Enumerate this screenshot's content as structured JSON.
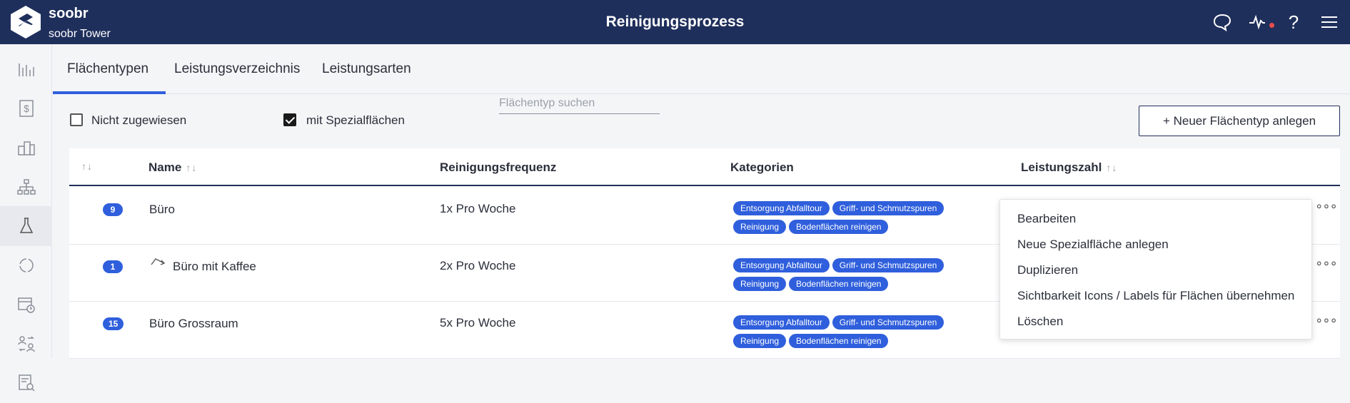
{
  "app": {
    "brand": "soobr",
    "location": "soobr Tower",
    "page_title": "Reinigungsprozess"
  },
  "colors": {
    "topbar": "#1f2f5c",
    "accent": "#2f5fdc",
    "notification_dot": "#e94c4c"
  },
  "header_icons": [
    "chat-icon",
    "activity-icon",
    "help-icon",
    "menu-icon"
  ],
  "help_label": "?",
  "sidebar_icons": [
    "bar-chart-icon",
    "dollar-document-icon",
    "buildings-icon",
    "hierarchy-icon",
    "flask-icon",
    "cycle-icon",
    "calendar-clock-icon",
    "people-swap-icon",
    "document-search-icon"
  ],
  "tabs": [
    {
      "label": "Flächentypen",
      "active": true
    },
    {
      "label": "Leistungsverzeichnis",
      "active": false
    },
    {
      "label": "Leistungsarten",
      "active": false
    }
  ],
  "filters": {
    "unassigned_label": "Nicht zugewiesen",
    "unassigned_checked": false,
    "special_label": "mit Spezialflächen",
    "special_checked": true,
    "search_placeholder": "Flächentyp suchen",
    "new_button": "+ Neuer Flächentyp anlegen"
  },
  "table": {
    "sort_arrows": "↑↓",
    "headers": {
      "name": "Name",
      "frequency": "Reinigungsfrequenz",
      "categories": "Kategorien",
      "performance": "Leistungszahl"
    },
    "rows": [
      {
        "count": "9",
        "name": "Büro",
        "frequency": "1x Pro Woche",
        "special": false,
        "categories": [
          "Entsorgung Abfalltour",
          "Griff- und Schmutzspuren",
          "Reinigung",
          "Bodenflächen reinigen"
        ]
      },
      {
        "count": "1",
        "name": "Büro mit Kaffee",
        "frequency": "2x Pro Woche",
        "special": true,
        "categories": [
          "Entsorgung Abfalltour",
          "Griff- und Schmutzspuren",
          "Reinigung",
          "Bodenflächen reinigen"
        ]
      },
      {
        "count": "15",
        "name": "Büro Grossraum",
        "frequency": "5x Pro Woche",
        "special": false,
        "categories": [
          "Entsorgung Abfalltour",
          "Griff- und Schmutzspuren",
          "Reinigung",
          "Bodenflächen reinigen"
        ]
      }
    ],
    "row_menu_label": "∘∘∘"
  },
  "context_menu": {
    "items": [
      "Bearbeiten",
      "Neue Spezialfläche anlegen",
      "Duplizieren",
      "Sichtbarkeit Icons / Labels für Flächen übernehmen",
      "Löschen"
    ]
  }
}
